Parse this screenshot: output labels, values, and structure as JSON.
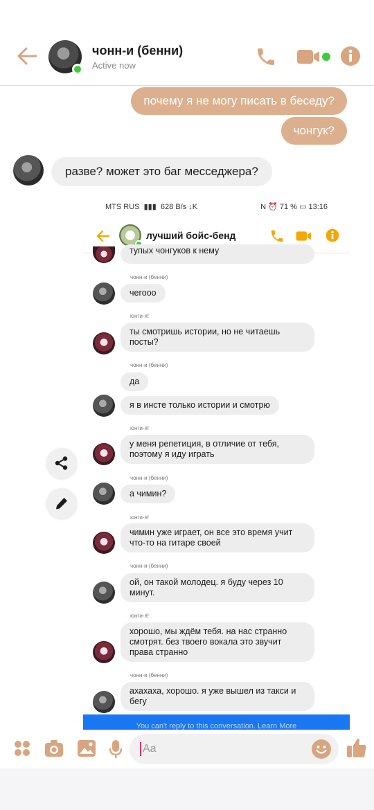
{
  "header": {
    "title": "чонн-и (бенни)",
    "status": "Active now"
  },
  "messages": {
    "out1": "почему я не могу писать в беседу?",
    "out2": "чонгук?",
    "in1": "разве? может это баг месседжера?"
  },
  "embedded": {
    "status_bar": {
      "carrier": "MTS RUS",
      "speed": "628 B/s",
      "battery": "71 %",
      "time": "13:16"
    },
    "title": "лучший бойс-бенд",
    "messages": [
      {
        "sender": "",
        "text": "тупых чонгуков к нему"
      },
      {
        "sender": "чонн-и (бенни)",
        "text": "чегооо"
      },
      {
        "sender": "юнги-я!",
        "text": "ты смотришь истории, но не читаешь посты?"
      },
      {
        "sender": "чонн-и (бенни)",
        "text": "да"
      },
      {
        "sender": "",
        "text": "я в инсте только истории и смотрю"
      },
      {
        "sender": "юнги-я!",
        "text": "у меня репетиция, в отличие от тебя, поэтому я иду играть"
      },
      {
        "sender": "чонн-и (бенни)",
        "text": "а чимин?"
      },
      {
        "sender": "юнги-я!",
        "text": "чимин уже играет, он все это время учит что-то на гитаре своей"
      },
      {
        "sender": "чонн-и (бенни)",
        "text": "ой, он такой молодец. я буду через 10 минут."
      },
      {
        "sender": "юнги-я!",
        "text": "хорошо, мы ждём тебя. на нас странно смотрят. без твоего вокала это звучит права странно"
      },
      {
        "sender": "чонн-и (бенни)",
        "text": "ахахаха, хорошо. я уже вышел из такси и бегу"
      }
    ],
    "banner": "You can't reply to this conversation. Learn More"
  },
  "composer": {
    "placeholder": "Aa"
  },
  "colors": {
    "accent": "#d9a580",
    "bubble_out": "#dcb08e",
    "bubble_in": "#efefef",
    "online": "#3ecb3e",
    "embedded_accent": "#f5a700",
    "banner_blue": "#1a77f2"
  },
  "icons": [
    "back-arrow-icon",
    "phone-icon",
    "video-icon",
    "info-icon",
    "share-icon",
    "pencil-icon",
    "apps-icon",
    "camera-icon",
    "gallery-icon",
    "microphone-icon",
    "emoji-icon",
    "thumbs-up-icon"
  ]
}
